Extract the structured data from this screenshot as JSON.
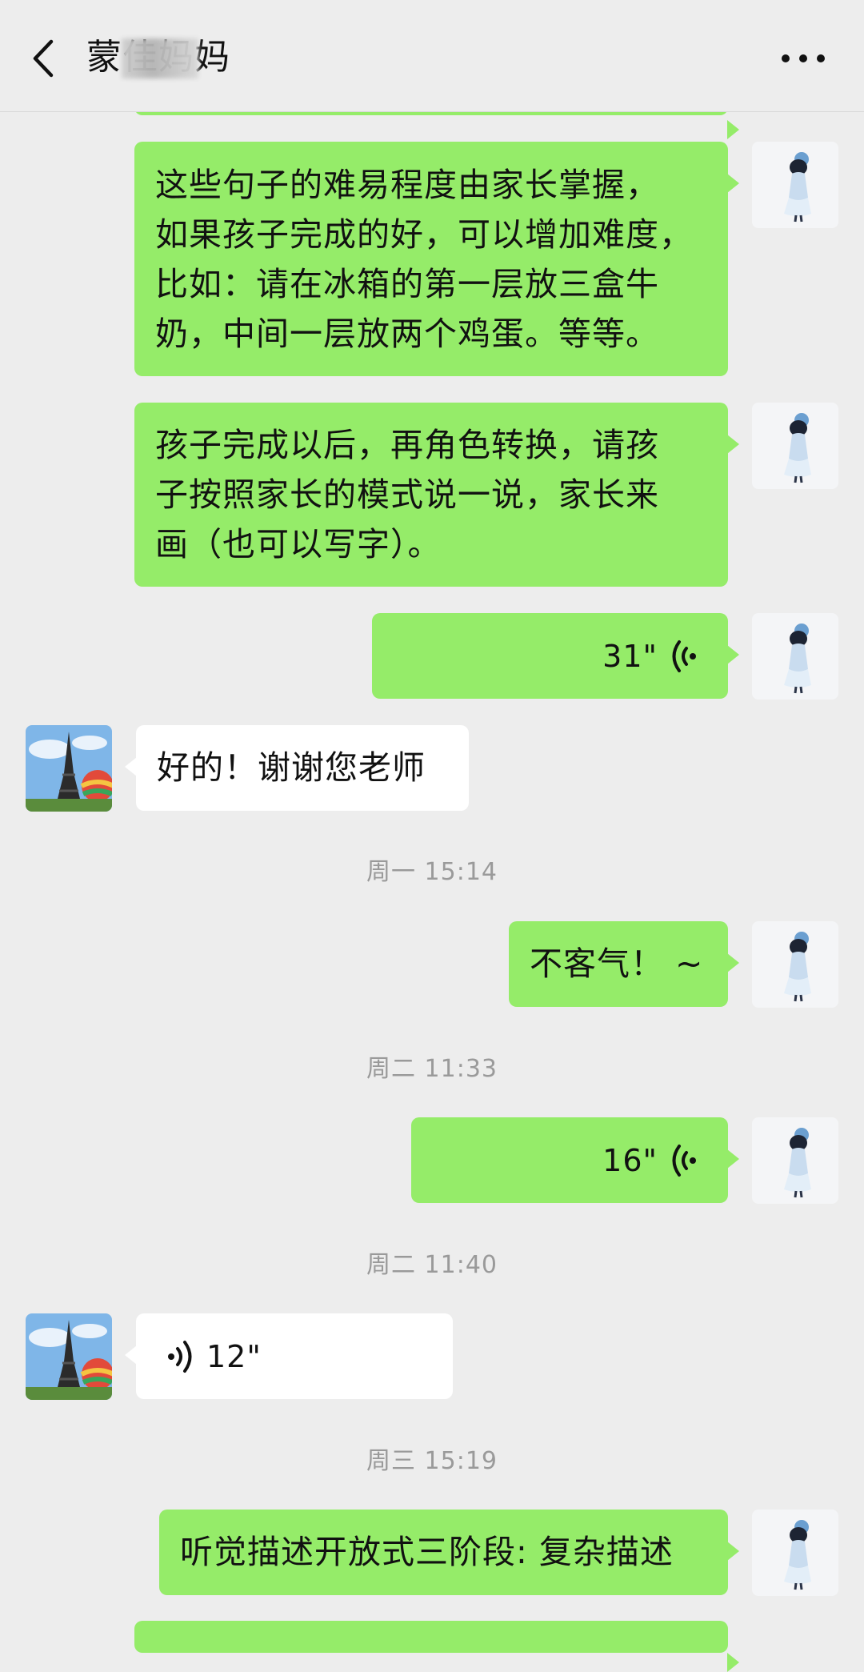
{
  "header": {
    "title": "蒙佳妈妈",
    "back_icon": "chevron-left-icon",
    "more_icon": "more-dots-icon"
  },
  "colors": {
    "sent_bubble": "#95ec69",
    "received_bubble": "#ffffff",
    "background": "#ededed"
  },
  "messages": [
    {
      "type": "text",
      "from": "me",
      "text": "这些句子的难易程度由家长掌握，\n如果孩子完成的好，可以增加难度，\n比如：请在冰箱的第一层放三盒牛\n奶，中间一层放两个鸡蛋。等等。"
    },
    {
      "type": "text",
      "from": "me",
      "text": "孩子完成以后，再角色转换，请孩\n子按照家长的模式说一说，家长来\n画（也可以写字）。"
    },
    {
      "type": "voice",
      "from": "me",
      "duration": "31\""
    },
    {
      "type": "text",
      "from": "other",
      "text": "好的！谢谢您老师"
    },
    {
      "type": "time",
      "text": "周一 15:14"
    },
    {
      "type": "text",
      "from": "me",
      "text": "不客气！ ~"
    },
    {
      "type": "time",
      "text": "周二 11:33"
    },
    {
      "type": "voice",
      "from": "me",
      "duration": "16\""
    },
    {
      "type": "time",
      "text": "周二 11:40"
    },
    {
      "type": "voice",
      "from": "other",
      "duration": "12\""
    },
    {
      "type": "time",
      "text": "周三 15:19"
    },
    {
      "type": "text",
      "from": "me",
      "text": "听觉描述开放式三阶段: 复杂描述"
    }
  ]
}
